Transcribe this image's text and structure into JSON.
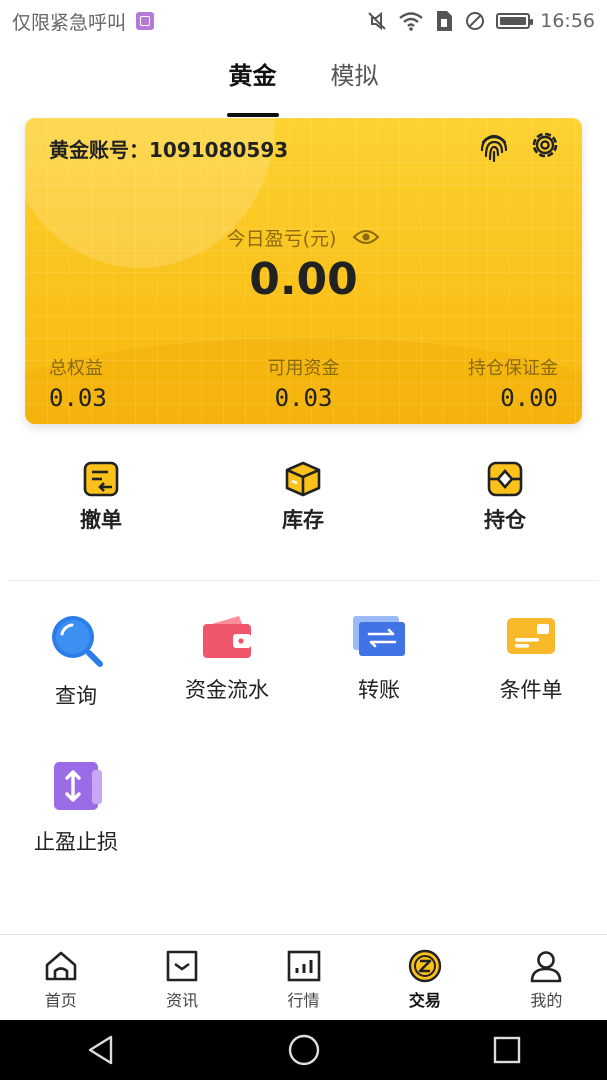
{
  "status_bar": {
    "carrier_text": "仅限紧急呼叫",
    "time": "16:56"
  },
  "tabs": [
    {
      "label": "黄金",
      "active": true
    },
    {
      "label": "模拟",
      "active": false
    }
  ],
  "account": {
    "label": "黄金账号：1091080593",
    "pnl_label": "今日盈亏(元)",
    "pnl_value": "0.00",
    "stats": [
      {
        "label": "总权益",
        "value": "0.03"
      },
      {
        "label": "可用资金",
        "value": "0.03"
      },
      {
        "label": "持仓保证金",
        "value": "0.00"
      }
    ]
  },
  "quick_actions": [
    {
      "label": "撤单",
      "icon": "cancel-order-icon"
    },
    {
      "label": "库存",
      "icon": "inventory-box-icon"
    },
    {
      "label": "持仓",
      "icon": "position-icon"
    }
  ],
  "functions": [
    {
      "label": "查询",
      "icon": "search-icon",
      "color": "#2b7de9"
    },
    {
      "label": "资金流水",
      "icon": "wallet-icon",
      "color": "#f0566b"
    },
    {
      "label": "转账",
      "icon": "transfer-icon",
      "color": "#3f73e6"
    },
    {
      "label": "条件单",
      "icon": "card-icon",
      "color": "#f7b82a"
    },
    {
      "label": "止盈止损",
      "icon": "stop-profit-loss-icon",
      "color": "#9b6ce8"
    }
  ],
  "bottom_nav": [
    {
      "label": "首页",
      "icon": "home-icon"
    },
    {
      "label": "资讯",
      "icon": "news-icon"
    },
    {
      "label": "行情",
      "icon": "market-chart-icon"
    },
    {
      "label": "交易",
      "icon": "trade-icon",
      "active": true
    },
    {
      "label": "我的",
      "icon": "profile-icon"
    }
  ],
  "colors": {
    "gold": "#f9c11a",
    "accent": "#111111"
  }
}
